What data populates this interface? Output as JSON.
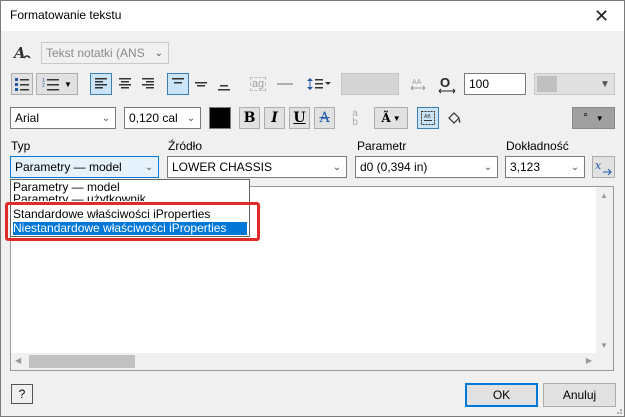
{
  "window": {
    "title": "Formatowanie tekstu"
  },
  "toolbar1": {
    "style_value": "Tekst notatki (ANS",
    "spacing_value": "100"
  },
  "toolbar2": {
    "font_value": "Arial",
    "size_value": "0,120 cal",
    "bold": "B",
    "italic": "I",
    "underline": "U",
    "strike": "A",
    "circle_value": "°"
  },
  "labels": {
    "typ": "Typ",
    "zrodlo": "Źródło",
    "parametr": "Parametr",
    "dokladnosc": "Dokładność"
  },
  "fields": {
    "typ_value": "Parametry — model",
    "zrodlo_value": "LOWER CHASSIS",
    "parametr_value": "d0 (0,394 in)",
    "dokladnosc_value": "3,123"
  },
  "dropdown": {
    "items": [
      "Parametry — model",
      "Parametry — użytkownik",
      "Standardowe właściwości iProperties",
      "Niestandardowe właściwości iProperties"
    ]
  },
  "footer": {
    "ok": "OK",
    "cancel": "Anuluj",
    "help": "?"
  },
  "colors": {
    "accent": "#0078d7",
    "highlight": "#e02b2b"
  }
}
